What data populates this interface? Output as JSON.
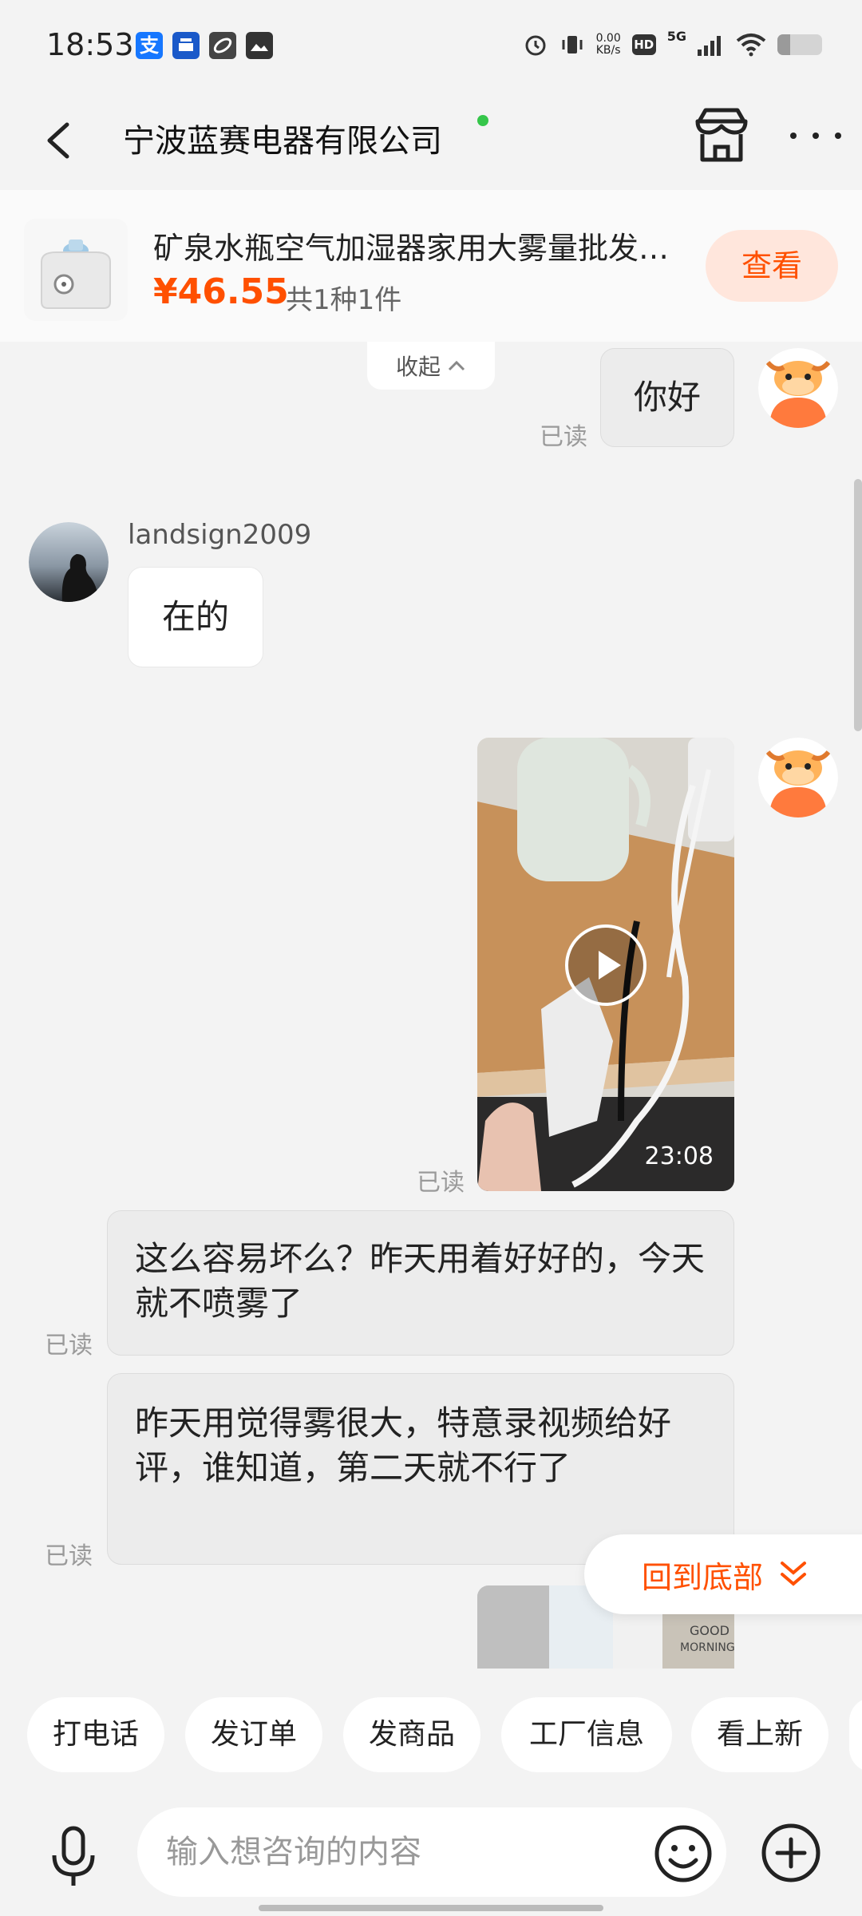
{
  "status_bar": {
    "time": "18:53",
    "net_speed_value": "0.00",
    "net_speed_unit": "KB/s",
    "hd": "HD",
    "signal": "5G",
    "icons": [
      "alipay-icon",
      "bank-icon",
      "link-icon",
      "gallery-icon",
      "alarm-icon",
      "vibrate-icon",
      "signal-icon",
      "wifi-icon",
      "battery-icon"
    ]
  },
  "header": {
    "title": "宁波蓝赛电器有限公司",
    "online": true
  },
  "product": {
    "title": "矿泉水瓶空气加湿器家用大雾量批发迷你",
    "price": "¥46.55",
    "quantity": "共1种1件",
    "view_label": "查看"
  },
  "chat": {
    "collapse_label": "收起",
    "read_label": "已读",
    "other_user": "landsign2009",
    "messages": [
      {
        "from": "me",
        "type": "text",
        "text": "你好"
      },
      {
        "from": "other",
        "type": "text",
        "text": "在的"
      },
      {
        "from": "me",
        "type": "video",
        "duration": "23:08"
      },
      {
        "from": "me",
        "type": "text",
        "text": "这么容易坏么？昨天用着好好的，今天就不喷雾了"
      },
      {
        "from": "me",
        "type": "text",
        "text": "昨天用觉得雾很大，特意录视频给好评，谁知道，第二天就不行了"
      },
      {
        "from": "me",
        "type": "image"
      }
    ],
    "image_text_1": "GOOD",
    "image_text_2": "MORNING",
    "back_to_bottom": "回到底部"
  },
  "quick_actions": [
    "打电话",
    "发订单",
    "发商品",
    "工厂信息",
    "看上新"
  ],
  "input": {
    "placeholder": "输入想咨询的内容"
  },
  "colors": {
    "accent": "#ff5000",
    "accent_bg": "#ffe6dc",
    "online": "#35c64a",
    "background": "#f3f3f3"
  }
}
